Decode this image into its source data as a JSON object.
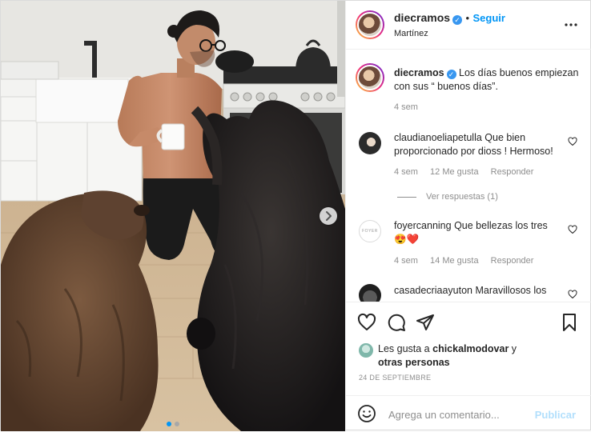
{
  "post": {
    "author": "diecramos",
    "location": "Martínez",
    "follow_label": "Seguir",
    "more_icon": "more-horizontal-icon",
    "verified_icon": "verified-badge-icon",
    "caption": {
      "username": "diecramos",
      "text": "Los días buenos empiezan con sus “ buenos días”.",
      "time": "4 sem"
    },
    "comments": [
      {
        "username": "claudianoeliapetulla",
        "text": "Que bien proporcionado por dioss ! Hermoso!",
        "time": "4 sem",
        "likes": "12 Me gusta",
        "reply": "Responder",
        "view_replies": "Ver respuestas (1)"
      },
      {
        "username": "foyercanning",
        "text": "Que bellezas los tres",
        "emoji": "😍❤️",
        "avatar_text": "FOYER",
        "time": "4 sem",
        "likes": "14 Me gusta",
        "reply": "Responder"
      },
      {
        "username": "casadecriaayuton",
        "text": "Maravillosos los"
      }
    ],
    "liked_by": {
      "prefix": "Les gusta a",
      "user": "chickalmodovar",
      "suffix": "y",
      "others": "otras personas"
    },
    "date": "24 DE SEPTIEMBRE",
    "composer": {
      "placeholder": "Agrega un comentario...",
      "publish_label": "Publicar",
      "emoji_icon": "emoji-smiley-icon"
    },
    "icons": {
      "like": "heart-icon",
      "comment": "comment-bubble-icon",
      "share": "paper-plane-icon",
      "save": "bookmark-icon",
      "next": "chevron-right-icon"
    },
    "carousel": {
      "total_slides": 2,
      "current_slide": 1
    },
    "colors": {
      "accent": "#0095f6",
      "publish_disabled": "#b2dffc",
      "verified": "#3897f0",
      "like_red": "#ed4956"
    }
  }
}
